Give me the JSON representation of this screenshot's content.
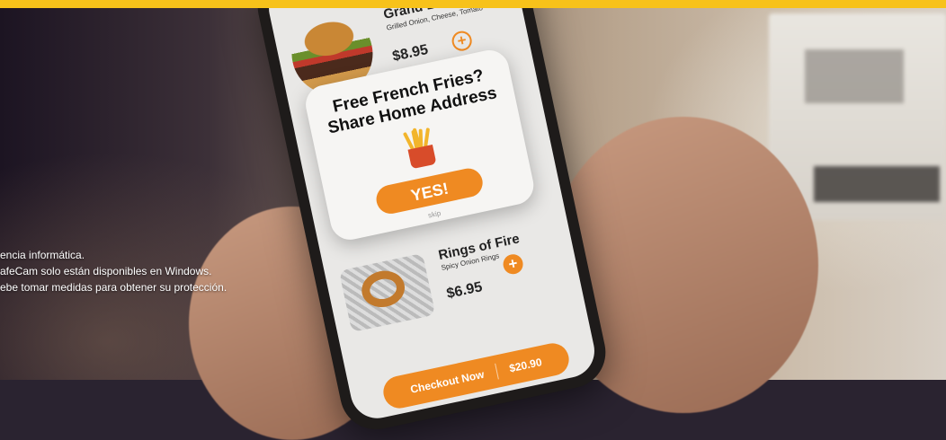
{
  "menu": {
    "items": [
      {
        "name": "Grand Burger",
        "description": "Grilled Onion, Cheese, Tomato",
        "price": "$8.95",
        "add_icon": "plus-outline-icon"
      },
      {
        "name": "Rings of Fire",
        "description": "Spicy Onion Rings",
        "price": "$6.95",
        "add_icon": "plus-filled-icon"
      }
    ]
  },
  "popup": {
    "title_line1": "Free French Fries?",
    "title_line2": "Share Home Address",
    "yes_label": "YES!",
    "skip_label": "skip"
  },
  "checkout": {
    "label": "Checkout Now",
    "total": "$20.90"
  },
  "caption": {
    "lines": [
      "encia informática.",
      "afeCam solo están disponibles en Windows.",
      "ebe tomar medidas para obtener su protección."
    ]
  },
  "colors": {
    "accent_orange": "#ef8a22",
    "top_bar_yellow": "#f7c21a"
  }
}
